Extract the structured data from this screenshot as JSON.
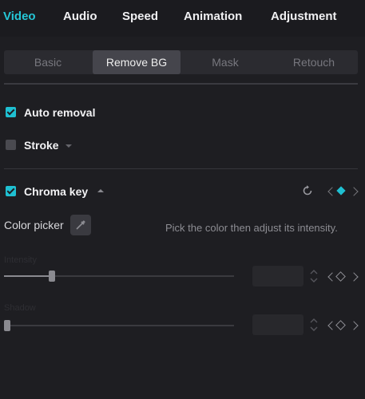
{
  "tabs": [
    "Video",
    "Audio",
    "Speed",
    "Animation",
    "Adjustment"
  ],
  "active_tab": "Video",
  "sub_tabs": [
    "Basic",
    "Remove BG",
    "Mask",
    "Retouch"
  ],
  "active_sub_tab": "Remove BG",
  "auto_removal": {
    "label": "Auto removal",
    "checked": true
  },
  "stroke": {
    "label": "Stroke",
    "checked": false
  },
  "chroma_key": {
    "label": "Chroma key",
    "checked": true,
    "color_picker_label": "Color picker",
    "hint": "Pick the color then adjust its intensity.",
    "intensity": {
      "label": "Intensity",
      "value": 0.21
    },
    "shadow": {
      "label": "Shadow",
      "value": 0.0
    }
  },
  "colors": {
    "accent": "#1fc0d2",
    "background": "#1e1e22"
  }
}
